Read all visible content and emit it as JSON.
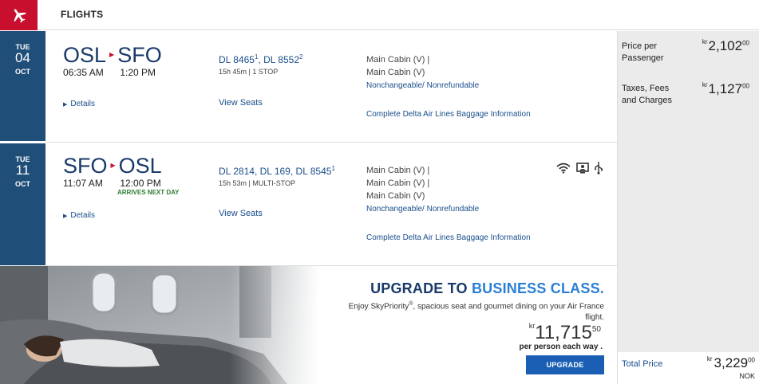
{
  "header": {
    "title": "FLIGHTS",
    "icon": "airplane-icon",
    "brand_color": "#c8102e"
  },
  "flights": [
    {
      "dow": "TUE",
      "day": "04",
      "month": "OCT",
      "origin": "OSL",
      "destination": "SFO",
      "depart_time": "06:35 AM",
      "arrive_time": "1:20 PM",
      "arrives_note": "",
      "details_label": "Details",
      "flight_numbers": [
        "DL 8465",
        "DL 8552"
      ],
      "flight_sups": [
        "1",
        "2"
      ],
      "duration": "15h 45m | 1 STOP",
      "view_seats": "View Seats",
      "cabins": [
        "Main Cabin (V) |",
        "Main Cabin (V)"
      ],
      "fare_rule": "Nonchangeable/ Nonrefundable",
      "baggage": "Complete Delta Air Lines Baggage Information"
    },
    {
      "dow": "TUE",
      "day": "11",
      "month": "OCT",
      "origin": "SFO",
      "destination": "OSL",
      "depart_time": "11:07 AM",
      "arrive_time": "12:00 PM",
      "arrives_note": "ARRIVES NEXT DAY",
      "details_label": "Details",
      "flight_numbers": [
        "DL 2814",
        "DL 169",
        "DL 8545"
      ],
      "flight_sups": [
        "",
        "",
        "1"
      ],
      "duration": "15h 53m | MULTI-STOP",
      "view_seats": "View Seats",
      "cabins": [
        "Main Cabin (V) |",
        "Main Cabin (V) |",
        "Main Cabin (V)"
      ],
      "fare_rule": "Nonchangeable/ Nonrefundable",
      "baggage": "Complete Delta Air Lines Baggage Information",
      "amenities": [
        "wifi-icon",
        "entertainment-screen-icon",
        "usb-icon"
      ]
    }
  ],
  "pricing": {
    "per_passenger_label": "Price per Passenger",
    "per_passenger_currency": "kr",
    "per_passenger_value": "2,102",
    "per_passenger_cents": "00",
    "taxes_label": "Taxes, Fees and Charges",
    "taxes_currency": "kr",
    "taxes_value": "1,127",
    "taxes_cents": "00",
    "total_label": "Total Price",
    "total_currency": "kr",
    "total_value": "3,229",
    "total_cents": "00",
    "total_code": "NOK"
  },
  "upgrade": {
    "title_prefix": "UPGRADE TO ",
    "title_highlight": "BUSINESS CLASS.",
    "desc_prefix": "Enjoy SkyPriority",
    "desc_mark": "®",
    "desc_suffix": ", spacious seat and gourmet dining on your Air France flight.",
    "price_currency": "kr",
    "price_value": "11,715",
    "price_cents": "50",
    "per_label": "per person each way .",
    "button_label": "UPGRADE"
  }
}
